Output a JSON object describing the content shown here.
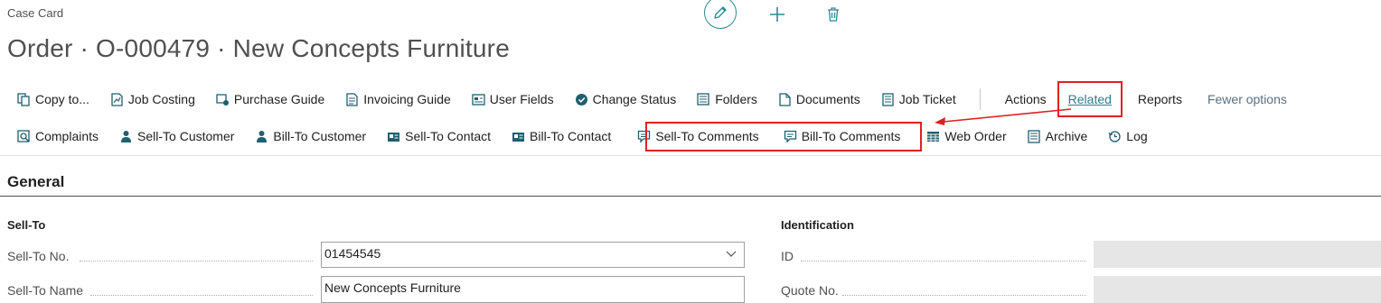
{
  "header": {
    "case_label": "Case Card",
    "title": "Order · O-000479 · New Concepts Furniture"
  },
  "toolbar_icons": [
    "edit-icon",
    "plus-icon",
    "trash-icon"
  ],
  "actions_row1": {
    "copy_to": "Copy to...",
    "job_costing": "Job Costing",
    "purchase_guide": "Purchase Guide",
    "invoicing_guide": "Invoicing Guide",
    "user_fields": "User Fields",
    "change_status": "Change Status",
    "folders": "Folders",
    "documents": "Documents",
    "job_ticket": "Job Ticket",
    "actions": "Actions",
    "related": "Related",
    "reports": "Reports",
    "fewer_options": "Fewer options"
  },
  "actions_row2": {
    "complaints": "Complaints",
    "sell_to_customer": "Sell-To Customer",
    "bill_to_customer": "Bill-To Customer",
    "sell_to_contact": "Sell-To Contact",
    "bill_to_contact": "Bill-To Contact",
    "sell_to_comments": "Sell-To Comments",
    "bill_to_comments": "Bill-To Comments",
    "web_order": "Web Order",
    "archive": "Archive",
    "log": "Log"
  },
  "section": {
    "title": "General"
  },
  "sell_to": {
    "heading": "Sell-To",
    "no_label": "Sell-To No.",
    "no_value": "01454545",
    "name_label": "Sell-To Name",
    "name_value": "New Concepts Furniture"
  },
  "identification": {
    "heading": "Identification",
    "id_label": "ID",
    "quote_label": "Quote No."
  },
  "colors": {
    "accent": "#2c8a93",
    "highlight": "#e02020",
    "divider": "#505050"
  }
}
